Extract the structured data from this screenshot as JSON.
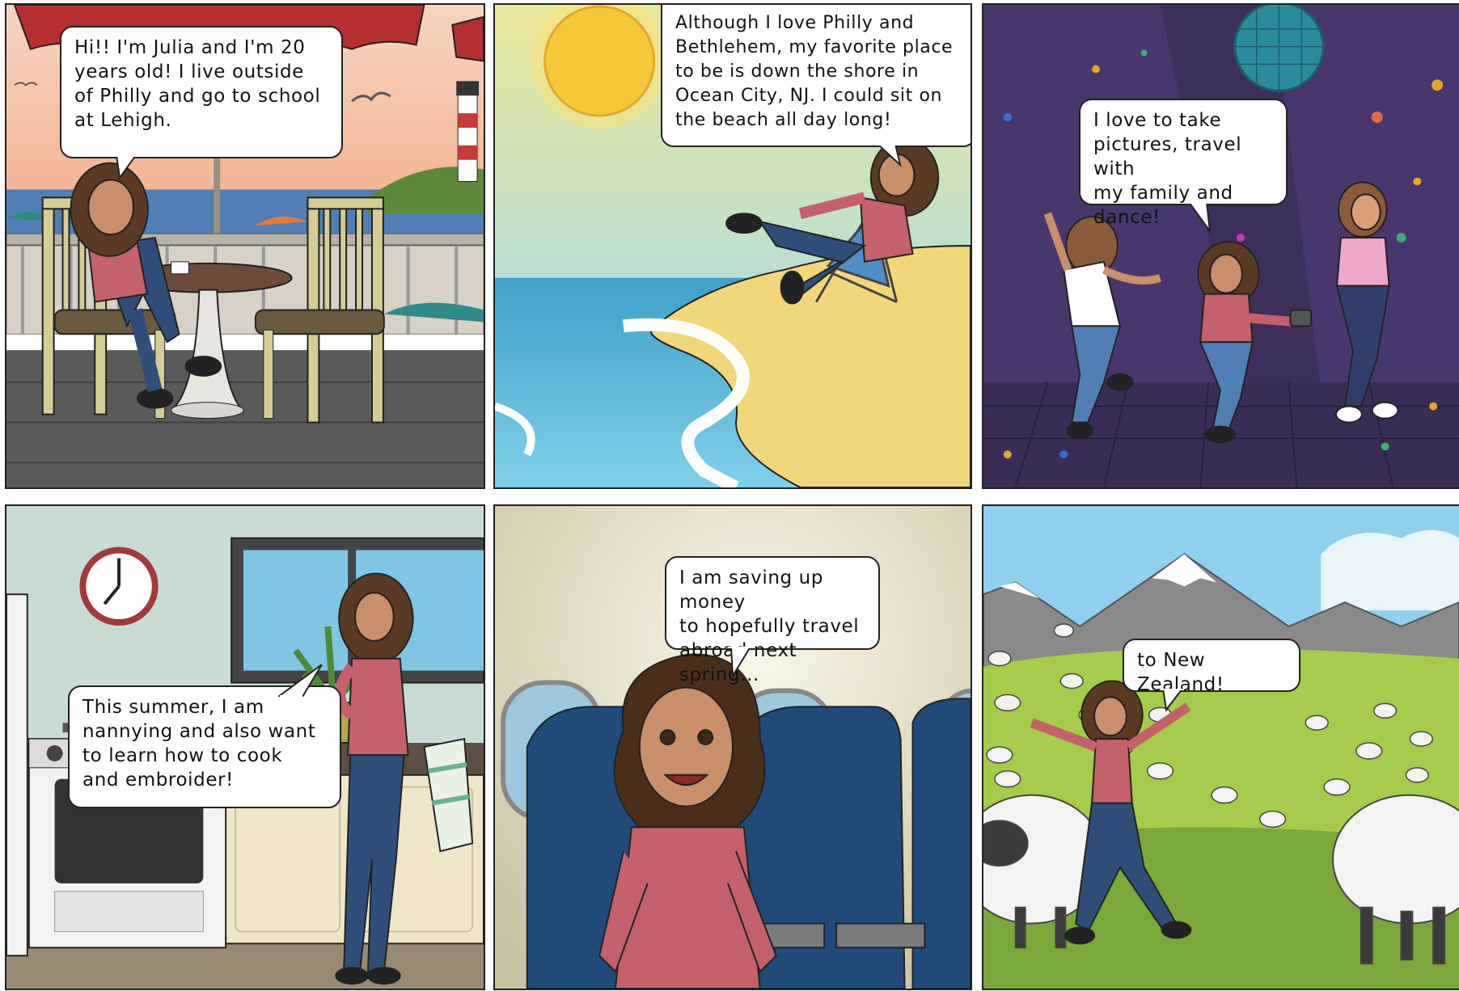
{
  "comic": {
    "panels": [
      {
        "scene": "cafe-terrace-by-sea",
        "speech": "Hi!! I'm Julia and I'm 20\nyears old! I live outside\nof Philly and go to school\nat Lehigh."
      },
      {
        "scene": "beach",
        "speech": "Although I love Philly and\nBethlehem, my favorite place\nto be is down the shore in\nOcean City, NJ. I could sit on\nthe beach all day long!"
      },
      {
        "scene": "dance-floor",
        "speech": "I love to take\npictures, travel with\nmy family and dance!"
      },
      {
        "scene": "kitchen",
        "speech": "This summer, I am\nnannying and also want\nto learn how to cook\nand embroider!"
      },
      {
        "scene": "airplane-seat",
        "speech": "I am saving up money\nto hopefully travel\nabroad next spring..."
      },
      {
        "scene": "new-zealand-sheep-field",
        "speech": "to New Zealand!"
      }
    ]
  },
  "colors": {
    "outline": "#222222",
    "shirt": "#c4616b",
    "jeans": "#2f4f7a",
    "hair": "#5a3a22",
    "skin": "#c98f6a"
  }
}
